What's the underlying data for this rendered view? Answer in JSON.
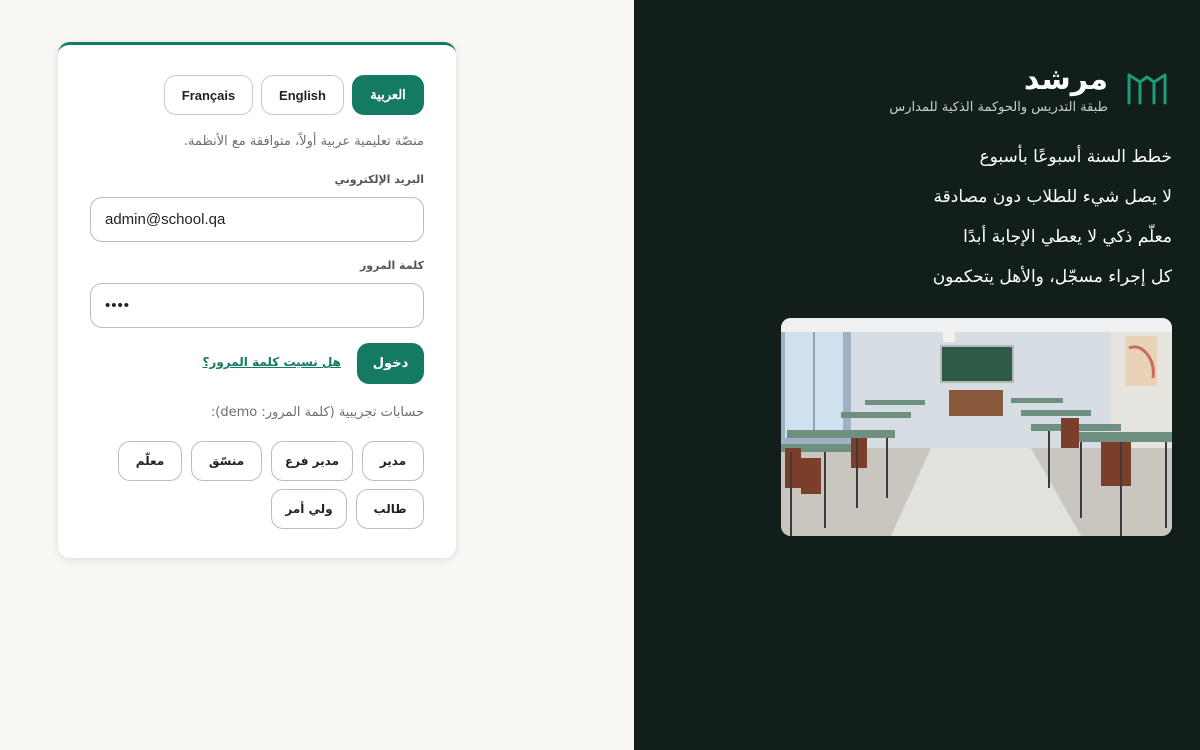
{
  "brand": {
    "name": "مرشد",
    "tagline": "طبقة التدريس والحوكمة الذكية للمدارس"
  },
  "features": [
    "خطط السنة أسبوعًا بأسبوع",
    "لا يصل شيء للطلاب دون مصادقة",
    "معلّم ذكي لا يعطي الإجابة أبدًا",
    "كل إجراء مسجّل، والأهل يتحكمون"
  ],
  "language": {
    "options": [
      "العربية",
      "English",
      "Français"
    ],
    "selected": "العربية"
  },
  "login": {
    "subtitle": "منصّة تعليمية عربية أولاً، متوافقة مع الأنظمة.",
    "email_label": "البريد الإلكتروني",
    "email_value": "admin@school.qa",
    "password_label": "كلمة المرور",
    "password_value": "••••",
    "submit_label": "دخول",
    "forgot_label": "هل نسيت كلمة المرور؟"
  },
  "demo": {
    "title": "حسابات تجريبية (كلمة المرور: demo):",
    "accounts": [
      "مدير",
      "مدير فرع",
      "منسّق",
      "معلّم",
      "طالب",
      "ولي أمر"
    ]
  },
  "colors": {
    "accent": "#157a62",
    "hero_background": "#121e19",
    "page_background": "#f8f7f3"
  },
  "icons": {
    "logo": "open-book-m-icon"
  }
}
